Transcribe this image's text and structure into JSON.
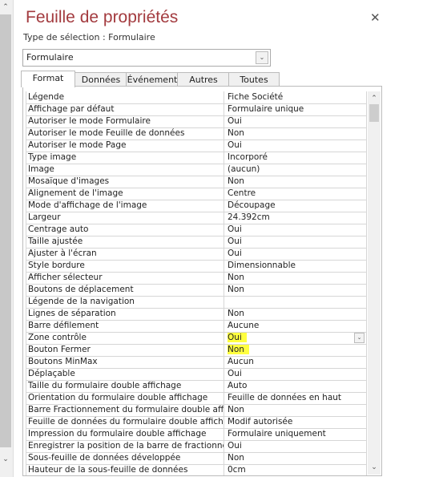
{
  "panel": {
    "title": "Feuille de propriétés",
    "selection_type": "Type de sélection :  Formulaire",
    "object_combo": "Formulaire",
    "highlight_color": "#ffff40",
    "title_color": "#a33b3f"
  },
  "tabs": [
    {
      "label": "Format",
      "active": true
    },
    {
      "label": "Données"
    },
    {
      "label": "Événement"
    },
    {
      "label": "Autres"
    },
    {
      "label": "Toutes"
    }
  ],
  "properties": [
    {
      "k": "Légende",
      "v": "Fiche Société"
    },
    {
      "k": "Affichage par défaut",
      "v": "Formulaire unique"
    },
    {
      "k": "Autoriser le mode Formulaire",
      "v": "Oui"
    },
    {
      "k": "Autoriser le mode Feuille de données",
      "v": "Non"
    },
    {
      "k": "Autoriser le mode Page",
      "v": "Oui"
    },
    {
      "k": "Type image",
      "v": "Incorporé"
    },
    {
      "k": "Image",
      "v": "(aucun)"
    },
    {
      "k": "Mosaïque d'images",
      "v": "Non"
    },
    {
      "k": "Alignement de l'image",
      "v": "Centre"
    },
    {
      "k": "Mode d'affichage de l'image",
      "v": "Découpage"
    },
    {
      "k": "Largeur",
      "v": "24.392cm"
    },
    {
      "k": "Centrage auto",
      "v": "Oui"
    },
    {
      "k": "Taille ajustée",
      "v": "Oui"
    },
    {
      "k": "Ajuster à l'écran",
      "v": "Oui"
    },
    {
      "k": "Style bordure",
      "v": "Dimensionnable"
    },
    {
      "k": "Afficher sélecteur",
      "v": "Non"
    },
    {
      "k": "Boutons de déplacement",
      "v": "Non"
    },
    {
      "k": "Légende de la navigation",
      "v": ""
    },
    {
      "k": "Lignes de séparation",
      "v": "Non"
    },
    {
      "k": "Barre défilement",
      "v": "Aucune"
    },
    {
      "k": "Zone contrôle",
      "v": "Oui",
      "highlight": true,
      "selected": true
    },
    {
      "k": "Bouton Fermer",
      "v": "Non",
      "highlight": true
    },
    {
      "k": "Boutons MinMax",
      "v": "Aucun"
    },
    {
      "k": "Déplaçable",
      "v": "Oui"
    },
    {
      "k": "Taille du formulaire double affichage",
      "v": "Auto"
    },
    {
      "k": "Orientation du formulaire double affichage",
      "v": "Feuille de données en haut"
    },
    {
      "k": "Barre Fractionnement du formulaire double affichage",
      "v": "Non"
    },
    {
      "k": "Feuille de données du formulaire double affichage",
      "v": "Modif autorisée"
    },
    {
      "k": "Impression du formulaire double affichage",
      "v": "Formulaire uniquement"
    },
    {
      "k": "Enregistrer la position de la barre de fractionnement",
      "v": "Oui"
    },
    {
      "k": "Sous-feuille de données développée",
      "v": "Non"
    },
    {
      "k": "Hauteur de la sous-feuille de données",
      "v": "0cm"
    }
  ]
}
